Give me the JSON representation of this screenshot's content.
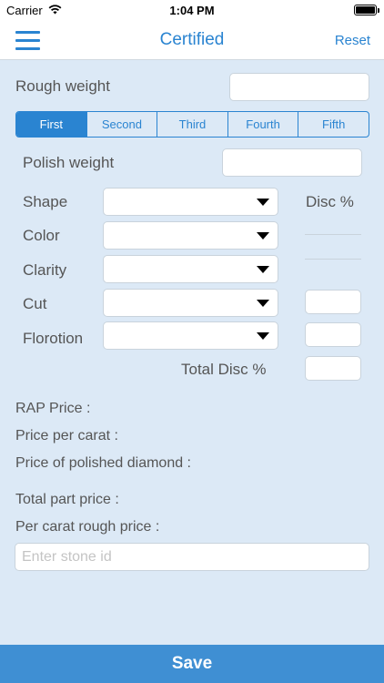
{
  "status_bar": {
    "carrier": "Carrier",
    "time": "1:04 PM",
    "wifi_icon": "wifi-icon",
    "battery_icon": "battery-icon"
  },
  "nav": {
    "title": "Certified",
    "reset_label": "Reset",
    "menu_icon": "hamburger-menu-icon"
  },
  "rough_weight": {
    "label": "Rough weight",
    "value": ""
  },
  "parts_tabs": [
    {
      "label": "First",
      "selected": true
    },
    {
      "label": "Second",
      "selected": false
    },
    {
      "label": "Third",
      "selected": false
    },
    {
      "label": "Fourth",
      "selected": false
    },
    {
      "label": "Fifth",
      "selected": false
    }
  ],
  "polish_weight": {
    "label": "Polish weight",
    "value": ""
  },
  "disc_header": "Disc %",
  "selectors": [
    {
      "label": "Shape",
      "value": ""
    },
    {
      "label": "Color",
      "value": ""
    },
    {
      "label": "Clarity",
      "value": ""
    },
    {
      "label": "Cut",
      "value": ""
    },
    {
      "label": "Florotion",
      "value": ""
    }
  ],
  "discounts": {
    "cut": "",
    "florotion": "",
    "total": ""
  },
  "total_disc_label": "Total Disc %",
  "results": {
    "rap_price": "RAP Price :",
    "price_per_carat": "Price per carat :",
    "price_polished": "Price of polished diamond :",
    "total_part_price": "Total part price :",
    "per_carat_rough_price": "Per carat rough price :"
  },
  "stone_id": {
    "placeholder": "Enter stone id",
    "value": ""
  },
  "save_label": "Save",
  "colors": {
    "accent": "#2a84d1",
    "background": "#dce9f6",
    "save_bar": "#3f8fd3"
  }
}
